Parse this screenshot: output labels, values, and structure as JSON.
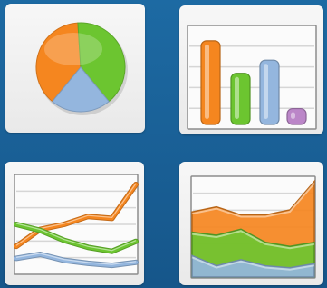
{
  "icons": [
    {
      "name": "pie-chart-icon"
    },
    {
      "name": "bar-chart-icon"
    },
    {
      "name": "line-chart-icon"
    },
    {
      "name": "area-chart-icon"
    }
  ],
  "colors": {
    "background": "#1d6aa3",
    "tile": "#f0f0f0",
    "orange": "#f5861f",
    "green": "#6cc530",
    "blue": "#94b6de",
    "purple": "#bb86c8"
  },
  "chart_data": [
    {
      "type": "pie",
      "values": [
        38,
        40,
        22
      ],
      "colors": [
        "#f5861f",
        "#6cc530",
        "#94b6de"
      ]
    },
    {
      "type": "bar",
      "values": [
        95,
        58,
        73,
        18
      ],
      "colors": [
        "#f5861f",
        "#6cc530",
        "#94b6de",
        "#bb86c8"
      ],
      "grid": true
    },
    {
      "type": "line",
      "grid": true,
      "series": [
        {
          "color": "#f5861f",
          "values": [
            28,
            45,
            50,
            58,
            56,
            90
          ]
        },
        {
          "color": "#6cc530",
          "values": [
            50,
            44,
            34,
            27,
            23,
            33
          ]
        },
        {
          "color": "#94b6de",
          "values": [
            16,
            20,
            14,
            11,
            9,
            12
          ]
        }
      ]
    },
    {
      "type": "area",
      "grid": true,
      "series": [
        {
          "color": "#f5861f",
          "values": [
            65,
            70,
            62,
            62,
            67,
            95
          ]
        },
        {
          "color": "#6cc530",
          "values": [
            45,
            42,
            48,
            35,
            31,
            35
          ]
        },
        {
          "color": "#94b6de",
          "values": [
            22,
            12,
            18,
            12,
            10,
            14
          ]
        }
      ]
    }
  ]
}
